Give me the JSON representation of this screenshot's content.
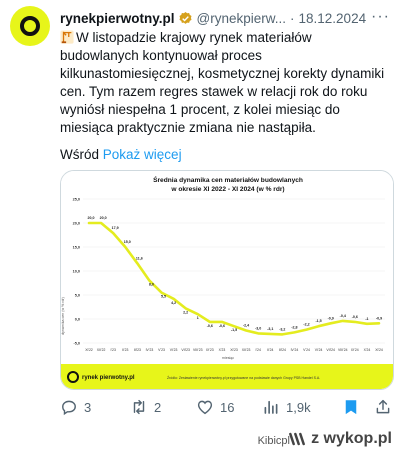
{
  "tweet": {
    "name": "rynekpierwotny.pl",
    "handle": "@rynekpierw...",
    "dot": "·",
    "date": "18.12.2024",
    "more": "···",
    "text": "W listopadzie krajowy rynek materiałów budowlanych kontynuował proces kilkunastomiesięcznej, kosmetycznej korekty dynamiki cen. Tym razem regres stawek w relacji rok do roku wyniósł niespełna 1 procent, z kolei miesiąc do miesiąca praktycznie zmiana nie nastąpiła.",
    "translate_prefix": "Wśród",
    "translate_link": "Pokaż więcej"
  },
  "chart_data": {
    "type": "line",
    "title": "Średnia dynamika cen materiałów budowlanych",
    "subtitle": "w okresie XI 2022 - XI 2024 (w % rdr)",
    "ylabel": "dynamika cen (w % rdr)",
    "xlabel": "miesiąc",
    "ylim": [
      -5,
      25
    ],
    "yticks": [
      "25,0",
      "20,0",
      "15,0",
      "10,0",
      "5,0",
      "0,0",
      "-5,0"
    ],
    "categories": [
      "XI'22",
      "XII'22",
      "I'23",
      "II'23",
      "III'23",
      "IV'23",
      "V'23",
      "VI'23",
      "VII'23",
      "VIII'23",
      "IX'23",
      "X'23",
      "XI'23",
      "XII'23",
      "I'24",
      "II'24",
      "III'24",
      "IV'24",
      "V'24",
      "VI'24",
      "VII'24",
      "VIII'24",
      "IX'24",
      "X'24",
      "XI'24"
    ],
    "values": [
      20.0,
      20.0,
      17.9,
      15.0,
      11.6,
      8.0,
      5.5,
      4.2,
      2.2,
      1.0,
      -0.6,
      -0.6,
      -1.5,
      -2.4,
      -3.0,
      -3.1,
      -3.2,
      -2.8,
      -2.2,
      -1.5,
      -0.9,
      -0.4,
      -0.6,
      -1.0,
      -0.9
    ],
    "labels": [
      "20,0",
      "20,0",
      "17,9",
      "15,0",
      "11,6",
      "8,0",
      "5,5",
      "4,2",
      "2,2",
      "1",
      "-0,6",
      "-0,6",
      "-1,5",
      "-2,4",
      "-3,0",
      "-3,1",
      "-3,2",
      "-2,8",
      "-2,2",
      "-1,5",
      "-0,9",
      "-0,4",
      "-0,6",
      "-1",
      "-0,9"
    ],
    "line_color": "#e4ec1f",
    "footer_logo": "rynek pierwotny.pl",
    "source": "Źródło: Zestawienie rynekpierwotny.pl przygotowane na podstawie danych Grupy PSB Handel S.A."
  },
  "actions": {
    "replies": "3",
    "retweets": "2",
    "likes": "16",
    "views": "1,9k"
  },
  "footer": {
    "author": "Kibicpl",
    "site": "z wykop.pl"
  },
  "colors": {
    "brand_yellow": "#e7f51a",
    "link_blue": "#1d9bf0",
    "muted": "#536471",
    "bookmark_blue": "#1d9bf0"
  }
}
